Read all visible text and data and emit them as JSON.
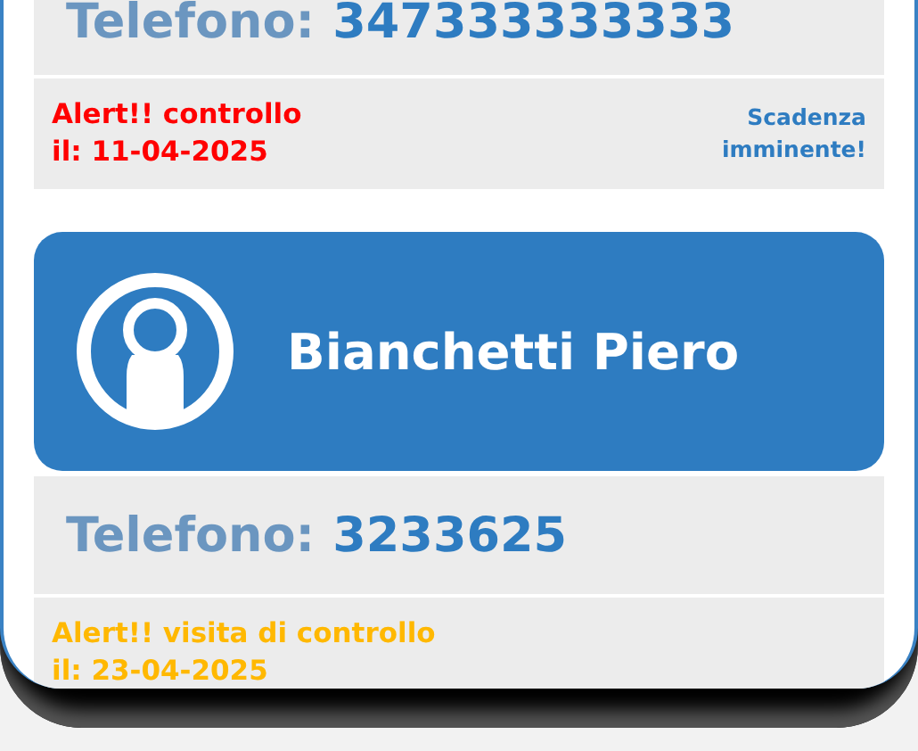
{
  "contacts": [
    {
      "phone_label": "Telefono:",
      "phone": "347333333333",
      "alert": {
        "text": "Alert!! controllo\nil: 11-04-2025",
        "color": "#ff0000",
        "note": "Scadenza\nimminente!"
      }
    },
    {
      "name": "Bianchetti Piero",
      "phone_label": "Telefono:",
      "phone": "3233625",
      "alert": {
        "text": "Alert!! visita di controllo\nil: 23-04-2025",
        "color": "#ffb800"
      }
    }
  ]
}
